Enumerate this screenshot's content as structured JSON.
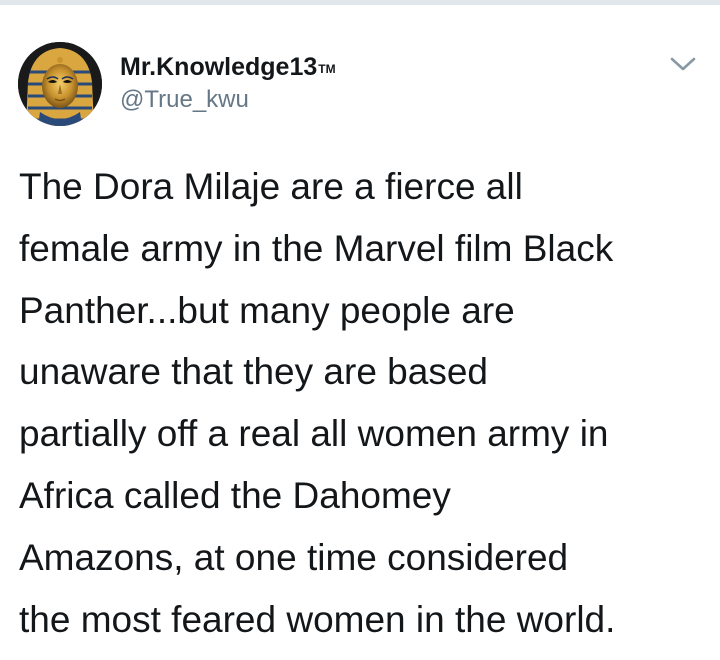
{
  "tweet": {
    "author": {
      "display_name": "Mr.Knowledge13",
      "display_name_suffix": "TM",
      "handle": "@True_kwu",
      "avatar_icon": "golden-pharaoh-mask-avatar"
    },
    "menu_icon": "chevron-down-icon",
    "text_lines": [
      "The Dora Milaje are a fierce all",
      "female army in the Marvel film Black",
      "Panther...but many people are",
      "unaware that they are based",
      "partially off a real all women army in",
      "Africa called the Dahomey",
      "Amazons, at one time considered",
      "the most feared women in the world."
    ]
  },
  "colors": {
    "text": "#14171a",
    "handle": "#657786",
    "chevron": "#8899a6",
    "divider": "#e1e8ed"
  }
}
